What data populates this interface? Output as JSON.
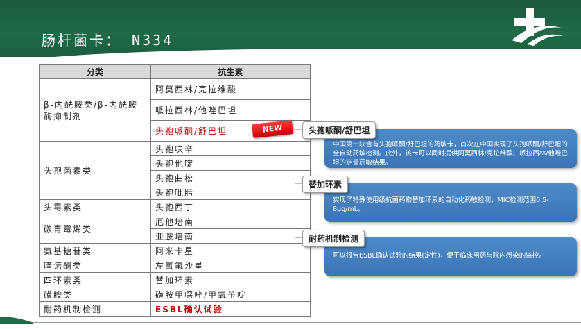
{
  "header": {
    "title": "肠杆菌卡： N334",
    "bg_color": "#1f6a47"
  },
  "table": {
    "headers": [
      "分类",
      "抗生素"
    ],
    "groups": [
      {
        "category": "β-内酰胺类/β-内酰胺酶抑制剂",
        "antibiotics": [
          "阿莫西林/克拉维酸",
          "哌拉西林/他唑巴坦",
          "头孢哌酮/舒巴坦"
        ]
      },
      {
        "category": "头孢菌素类",
        "antibiotics": [
          "头孢呋辛",
          "头孢他啶",
          "头孢曲松",
          "头孢吡肟"
        ]
      },
      {
        "category": "头霉素类",
        "antibiotics": [
          "头孢西丁"
        ]
      },
      {
        "category": "碳青霉烯类",
        "antibiotics": [
          "厄他培南",
          "亚胺培南"
        ]
      },
      {
        "category": "氨基糖苷类",
        "antibiotics": [
          "阿米卡星"
        ]
      },
      {
        "category": "喹诺酮类",
        "antibiotics": [
          "左氧氟沙星"
        ]
      },
      {
        "category": "四环素类",
        "antibiotics": [
          "替加环素"
        ]
      },
      {
        "category": "磺胺类",
        "antibiotics": [
          "磺胺甲噁唑/甲氧苄啶"
        ]
      },
      {
        "category": "耐药机制检测",
        "antibiotics": [
          "ESBL确认试验"
        ]
      }
    ],
    "new_badge": "NEW"
  },
  "cards": [
    {
      "label": "头孢哌酮/舒巴坦",
      "text": "中国第一块含有头孢哌酮/舒巴坦的药敏卡，首次在中国实现了头孢哌酮/舒巴坦的全自动药敏检测。此外，该卡可以同时提供阿莫西林/克拉维酸、哌拉西林/他唑巴坦的定量药敏结果。"
    },
    {
      "label": "替加环素",
      "text": "实现了特殊使用级抗菌药物替加环素的自动化药敏检测，MIC检测范围0.5-8μg/mL。"
    },
    {
      "label": "耐药机制检测",
      "text": "可以报告ESBL确认试验的结果(定性)，便于临床用药与院内感染的监控。"
    }
  ],
  "colors": {
    "card_blue": "#3f7bbd",
    "highlight_red": "#c00000",
    "header_green": "#1f6a47"
  }
}
